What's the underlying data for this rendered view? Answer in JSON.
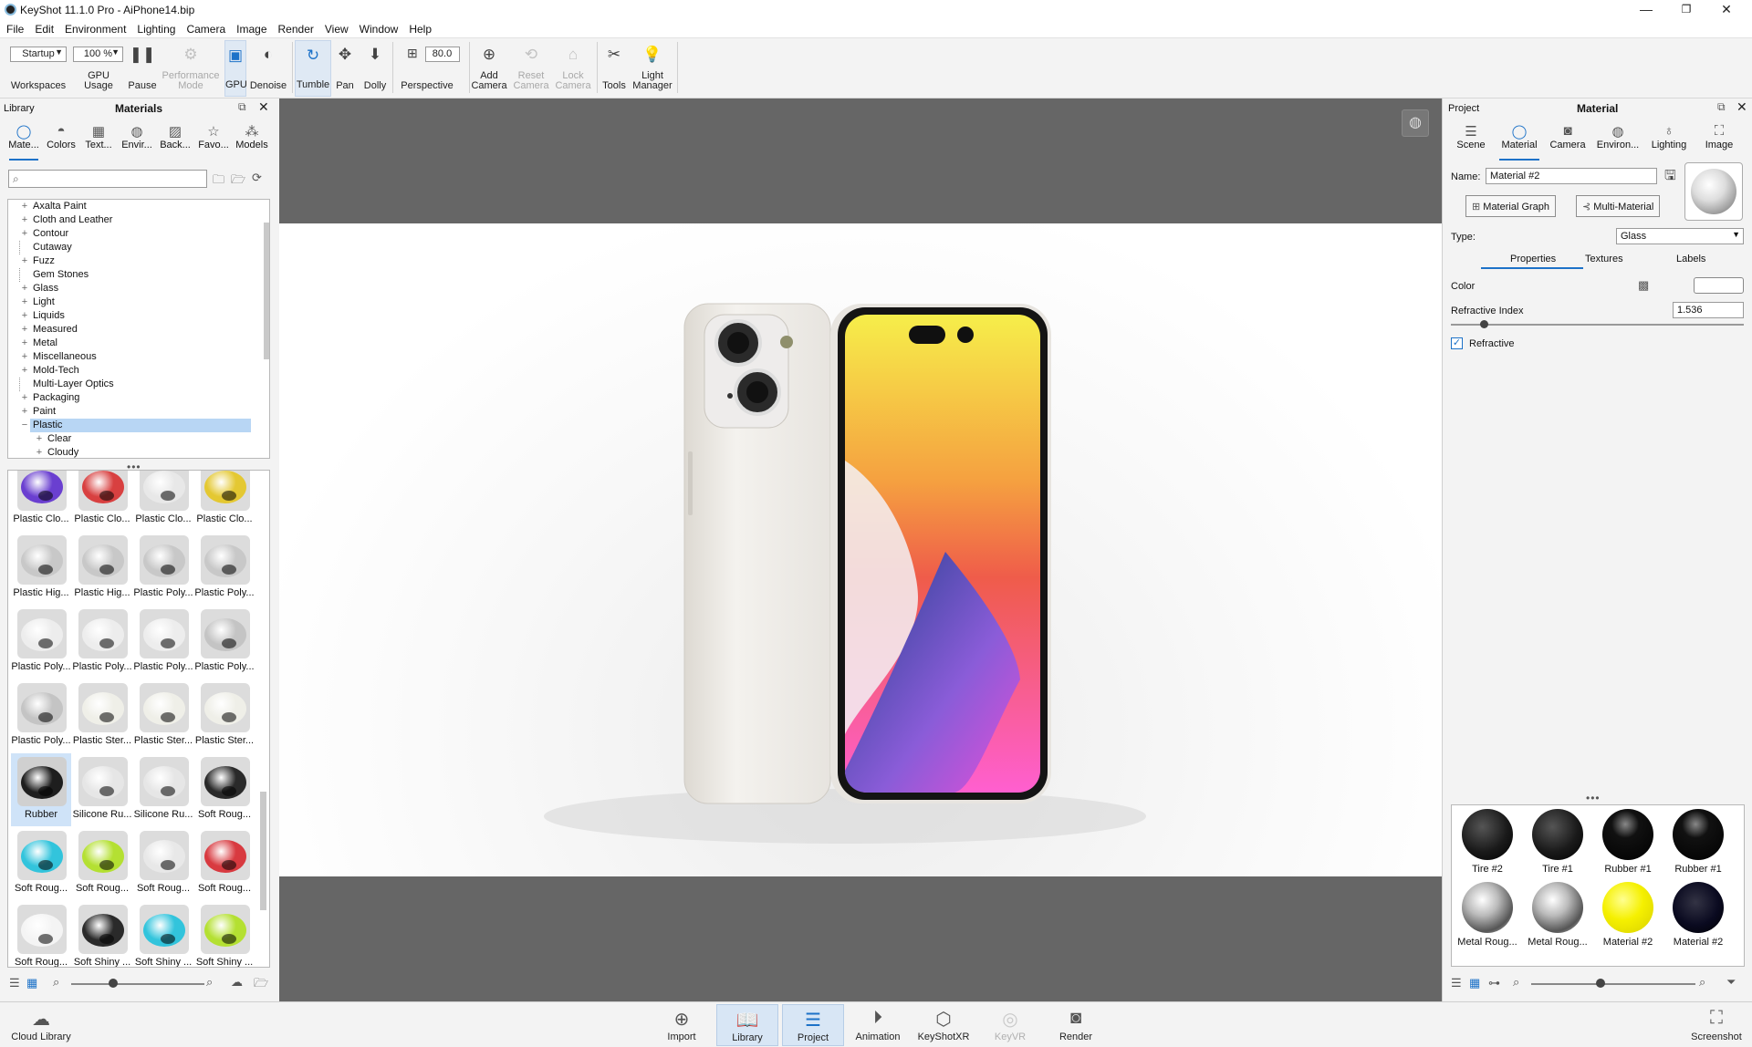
{
  "window": {
    "title": "KeyShot 11.1.0 Pro  - AiPhone14.bip",
    "minimize": "—",
    "maximize": "❐",
    "close": "✕"
  },
  "menu": [
    "File",
    "Edit",
    "Environment",
    "Lighting",
    "Camera",
    "Image",
    "Render",
    "View",
    "Window",
    "Help"
  ],
  "toolbar": {
    "workspace_value": "Startup",
    "workspaces_label": "Workspaces",
    "zoom_value": "100 %",
    "gpu_usage_label": "GPU Usage",
    "pause_label": "Pause",
    "perf_label_1": "Performance",
    "perf_label_2": "Mode",
    "gpu_label": "GPU",
    "denoise_label": "Denoise",
    "tumble_label": "Tumble",
    "pan_label": "Pan",
    "dolly_label": "Dolly",
    "fov_value": "80.0",
    "perspective_label": "Perspective",
    "add_camera_1": "Add",
    "add_camera_2": "Camera",
    "reset_camera_1": "Reset",
    "reset_camera_2": "Camera",
    "lock_camera_1": "Lock",
    "lock_camera_2": "Camera",
    "tools_label": "Tools",
    "light_manager_1": "Light",
    "light_manager_2": "Manager"
  },
  "library": {
    "panel_label": "Library",
    "title": "Materials",
    "tabs": [
      "Mate...",
      "Colors",
      "Text...",
      "Envir...",
      "Back...",
      "Favo...",
      "Models"
    ],
    "search_placeholder": "",
    "tree": [
      {
        "pm": "+",
        "label": "Axalta Paint",
        "indent": 0
      },
      {
        "pm": "+",
        "label": "Cloth and Leather",
        "indent": 0
      },
      {
        "pm": "+",
        "label": "Contour",
        "indent": 0
      },
      {
        "pm": "",
        "label": "Cutaway",
        "indent": 0
      },
      {
        "pm": "+",
        "label": "Fuzz",
        "indent": 0
      },
      {
        "pm": "",
        "label": "Gem Stones",
        "indent": 0
      },
      {
        "pm": "+",
        "label": "Glass",
        "indent": 0
      },
      {
        "pm": "+",
        "label": "Light",
        "indent": 0
      },
      {
        "pm": "+",
        "label": "Liquids",
        "indent": 0
      },
      {
        "pm": "+",
        "label": "Measured",
        "indent": 0
      },
      {
        "pm": "+",
        "label": "Metal",
        "indent": 0
      },
      {
        "pm": "+",
        "label": "Miscellaneous",
        "indent": 0
      },
      {
        "pm": "+",
        "label": "Mold-Tech",
        "indent": 0
      },
      {
        "pm": "",
        "label": "Multi-Layer Optics",
        "indent": 0
      },
      {
        "pm": "+",
        "label": "Packaging",
        "indent": 0
      },
      {
        "pm": "+",
        "label": "Paint",
        "indent": 0
      },
      {
        "pm": "−",
        "label": "Plastic",
        "indent": 0,
        "selected": true
      },
      {
        "pm": "+",
        "label": "Clear",
        "indent": 1
      },
      {
        "pm": "+",
        "label": "Cloudy",
        "indent": 1
      }
    ],
    "materials": [
      {
        "label": "Plastic Clo...",
        "color": "#6a3fd0"
      },
      {
        "label": "Plastic Clo...",
        "color": "#d84040"
      },
      {
        "label": "Plastic Clo...",
        "color": "#e8e8e8"
      },
      {
        "label": "Plastic Clo...",
        "color": "#e4c832"
      },
      {
        "label": "Plastic Hig...",
        "color": "#c8c8c8"
      },
      {
        "label": "Plastic Hig...",
        "color": "#c8c8c8"
      },
      {
        "label": "Plastic Poly...",
        "color": "#c8c8c8"
      },
      {
        "label": "Plastic Poly...",
        "color": "#c8c8c8"
      },
      {
        "label": "Plastic Poly...",
        "color": "#ededed"
      },
      {
        "label": "Plastic Poly...",
        "color": "#ededed"
      },
      {
        "label": "Plastic Poly...",
        "color": "#ededed"
      },
      {
        "label": "Plastic Poly...",
        "color": "#c4c4c4"
      },
      {
        "label": "Plastic Poly...",
        "color": "#c4c4c4"
      },
      {
        "label": "Plastic Ster...",
        "color": "#efefe8"
      },
      {
        "label": "Plastic Ster...",
        "color": "#efefe8"
      },
      {
        "label": "Plastic Ster...",
        "color": "#efefe8"
      },
      {
        "label": "Rubber",
        "color": "#1e1e1e",
        "selected": true
      },
      {
        "label": "Silicone Ru...",
        "color": "#e6e6e6"
      },
      {
        "label": "Silicone Ru...",
        "color": "#e6e6e6"
      },
      {
        "label": "Soft Roug...",
        "color": "#2a2a2a"
      },
      {
        "label": "Soft Roug...",
        "color": "#32c4dc"
      },
      {
        "label": "Soft Roug...",
        "color": "#b4e032"
      },
      {
        "label": "Soft Roug...",
        "color": "#e8e8e8"
      },
      {
        "label": "Soft Roug...",
        "color": "#d83a40"
      },
      {
        "label": "Soft Roug...",
        "color": "#f4f4f4"
      },
      {
        "label": "Soft Shiny ...",
        "color": "#2a2a2a"
      },
      {
        "label": "Soft Shiny ...",
        "color": "#32c4dc"
      },
      {
        "label": "Soft Shiny ...",
        "color": "#b4e032"
      }
    ]
  },
  "project": {
    "panel_label": "Project",
    "title": "Material",
    "tabs": [
      "Scene",
      "Material",
      "Camera",
      "Environ...",
      "Lighting",
      "Image"
    ],
    "name_label": "Name:",
    "name_value": "Material  #2",
    "material_graph": "Material Graph",
    "multi_material": "Multi-Material",
    "type_label": "Type:",
    "type_value": "Glass",
    "subtabs": [
      "Properties",
      "Textures",
      "Labels"
    ],
    "color_label": "Color",
    "refractive_index_label": "Refractive Index",
    "refractive_index_value": "1.536",
    "refractive_index_fraction": 0.1,
    "refractive_checkbox_label": "Refractive",
    "refractive_checked": true,
    "materials": [
      {
        "label": "Tire #2",
        "kind": "black-matte"
      },
      {
        "label": "Tire #1",
        "kind": "black-matte"
      },
      {
        "label": "Rubber #1",
        "kind": "black-gloss"
      },
      {
        "label": "Rubber #1",
        "kind": "black-gloss"
      },
      {
        "label": "Metal Roug...",
        "kind": "metal"
      },
      {
        "label": "Metal Roug...",
        "kind": "metal"
      },
      {
        "label": "Material  #2",
        "kind": "yellow"
      },
      {
        "label": "Material  #2",
        "kind": "dark-blue"
      }
    ]
  },
  "bottom": {
    "cloud_library": "Cloud Library",
    "buttons": [
      "Import",
      "Library",
      "Project",
      "Animation",
      "KeyShotXR",
      "KeyVR",
      "Render"
    ],
    "screenshot": "Screenshot"
  },
  "colors": {
    "accent": "#1d72c8",
    "selection": "#b8d6f4",
    "viewport_bg": "#666666"
  }
}
